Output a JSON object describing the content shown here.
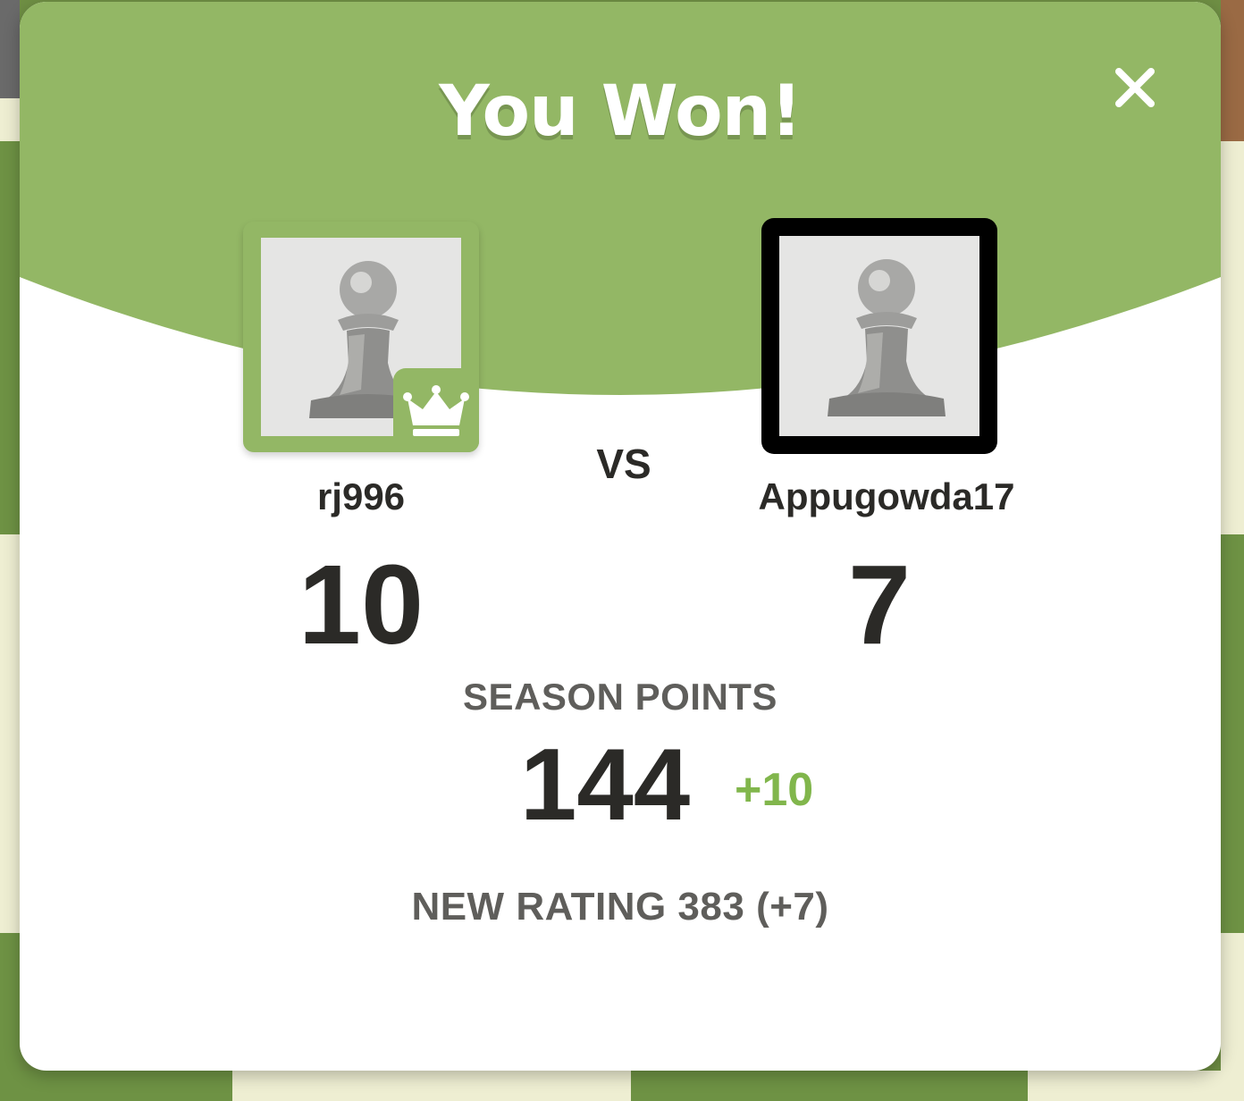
{
  "modal": {
    "title": "You Won!",
    "close_icon": "close-icon"
  },
  "players": [
    {
      "username": "rj996",
      "score": "10",
      "avatar_icon": "pawn-icon",
      "badge_icon": "crown-icon"
    },
    {
      "username": "Appugowda17",
      "score": "7",
      "avatar_icon": "pawn-icon"
    }
  ],
  "vs_label": "VS",
  "season": {
    "label": "SEASON POINTS",
    "value": "144",
    "delta": "+10"
  },
  "rating_text": "NEW RATING 383 (+7)",
  "colors": {
    "accent_green": "#93b765",
    "delta_green": "#81b64c",
    "text_dark": "#2b2a27",
    "text_muted": "#5f5e5b"
  }
}
